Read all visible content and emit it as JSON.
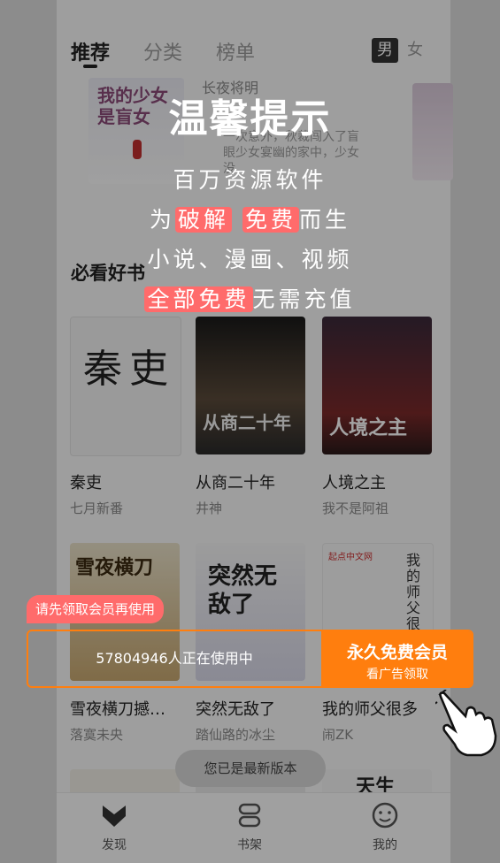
{
  "tabs": {
    "recommend": "推荐",
    "category": "分类",
    "ranking": "榜单"
  },
  "gender": {
    "male": "男",
    "female": "女"
  },
  "banner": {
    "title_art": "我的少女是盲女",
    "subtitle": "长夜将明",
    "desc": "一次意外，秋裁闯入了盲眼少女宴幽的家中，少女没"
  },
  "section_title": "必看好书",
  "row1": [
    {
      "title": "秦吏",
      "author": "七月新番",
      "cover_text": "秦吏"
    },
    {
      "title": "从商二十年",
      "author": "井神",
      "cover_text": "从商二十年"
    },
    {
      "title": "人境之主",
      "author": "我不是阿祖",
      "cover_text": "人境之主"
    }
  ],
  "row2": [
    {
      "title": "雪夜横刀撼…",
      "author": "落寞未央",
      "cover_text": "雪夜横刀"
    },
    {
      "title": "突然无敌了",
      "author": "踏仙路的冰尘",
      "cover_text": "突然无敌了"
    },
    {
      "title": "我的师父很多",
      "author": "闹ZK",
      "cover_text": "我的师父很多",
      "cover_badge": "起点中文网"
    }
  ],
  "row3_partial": {
    "text": "天生"
  },
  "toast": "您已是最新版本",
  "bottom_nav": [
    {
      "label": "发现",
      "icon": "discover-icon"
    },
    {
      "label": "书架",
      "icon": "bookshelf-icon"
    },
    {
      "label": "我的",
      "icon": "profile-icon"
    }
  ],
  "promo": {
    "title": "温馨提示",
    "line1": "百万资源软件",
    "line2_pre": "为",
    "line2_hl1": "破解",
    "line2_hl2": "免费",
    "line2_post": "而生",
    "line3": "小说、漫画、视频",
    "line4_hl": "全部免费",
    "line4_post": "无需充值"
  },
  "member": {
    "badge": "请先领取会员再使用",
    "users_text": "57804946人正在使用中",
    "cta_main": "永久免费会员",
    "cta_sub": "看广告领取"
  },
  "colors": {
    "accent": "#ff7e0e",
    "highlight": "#ff6b6b",
    "badge": "#ff6b6b"
  }
}
